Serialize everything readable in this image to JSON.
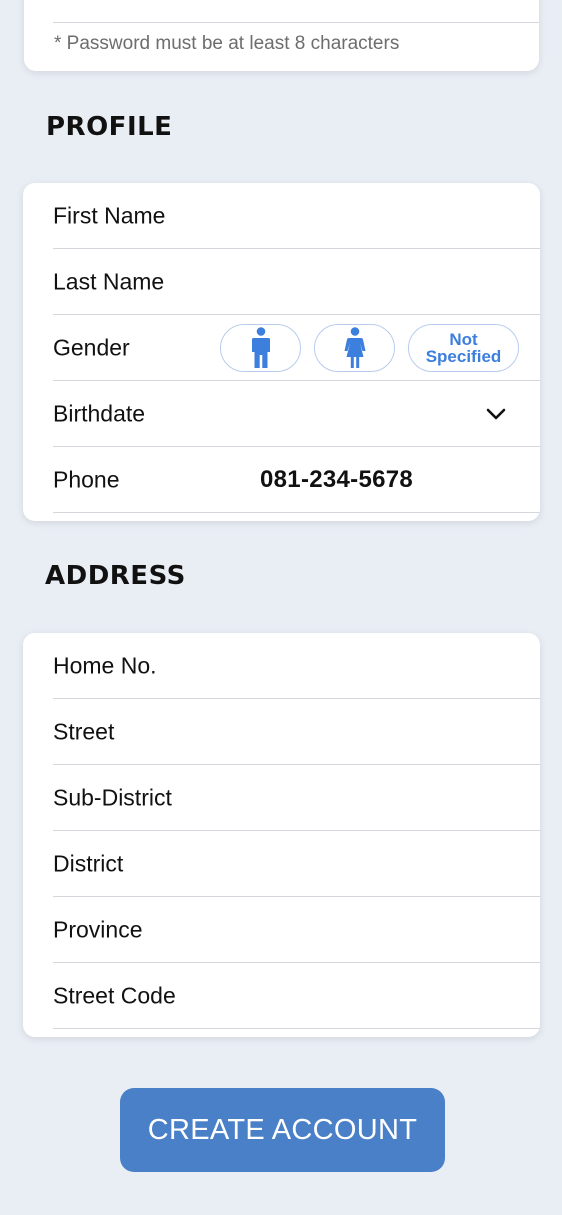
{
  "password": {
    "note": "* Password must be at least 8 characters"
  },
  "profile": {
    "title": "PROFILE",
    "first_name_label": "First Name",
    "last_name_label": "Last Name",
    "gender_label": "Gender",
    "gender_options": {
      "male_icon": "male-person-icon",
      "female_icon": "female-person-icon",
      "not_specified_line1": "Not",
      "not_specified_line2": "Specified"
    },
    "birthdate_label": "Birthdate",
    "phone_label": "Phone",
    "phone_value": "081-234-5678"
  },
  "address": {
    "title": "ADDRESS",
    "fields": [
      "Home No.",
      "Street",
      "Sub-District",
      "District",
      "Province",
      "Street Code"
    ]
  },
  "actions": {
    "create_account": "CREATE ACCOUNT"
  },
  "colors": {
    "background": "#e9eef5",
    "accent": "#4a80c7",
    "icon_blue": "#3d7fdc"
  }
}
